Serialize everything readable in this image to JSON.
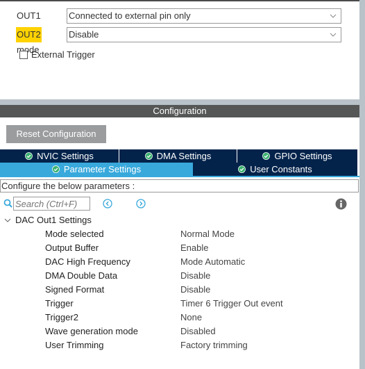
{
  "mode_panel": {
    "out1": {
      "label": "OUT1 mode",
      "value": "Connected to external pin only"
    },
    "out2": {
      "label": "OUT2 mode",
      "value": "Disable"
    },
    "external_trigger": {
      "label": "External Trigger",
      "checked": false
    }
  },
  "configuration": {
    "header": "Configuration",
    "reset_button": "Reset Configuration",
    "tabs_row1": [
      {
        "label": "NVIC Settings"
      },
      {
        "label": "DMA Settings"
      },
      {
        "label": "GPIO Settings"
      }
    ],
    "tabs_row2": [
      {
        "label": "Parameter Settings",
        "active": true
      },
      {
        "label": "User Constants"
      }
    ],
    "info_text": "Configure the below parameters :",
    "search": {
      "placeholder": "Search (Ctrl+F)",
      "value": ""
    },
    "group": {
      "title": "DAC Out1 Settings",
      "params": [
        {
          "name": "Mode selected",
          "value": "Normal Mode"
        },
        {
          "name": "Output Buffer",
          "value": "Enable"
        },
        {
          "name": "DAC High Frequency",
          "value": "Mode Automatic"
        },
        {
          "name": "DMA Double Data",
          "value": "Disable"
        },
        {
          "name": "Signed Format",
          "value": "Disable"
        },
        {
          "name": "Trigger",
          "value": "Timer 6 Trigger Out event"
        },
        {
          "name": "Trigger2",
          "value": "None"
        },
        {
          "name": "Wave generation mode",
          "value": "Disabled"
        },
        {
          "name": "User Trimming",
          "value": "Factory trimming"
        }
      ]
    }
  },
  "colors": {
    "highlight": "#ffd200",
    "tab_dark": "#03234b",
    "tab_active": "#39a9dc",
    "check_green": "#3cb371",
    "header_bg": "#555656"
  }
}
